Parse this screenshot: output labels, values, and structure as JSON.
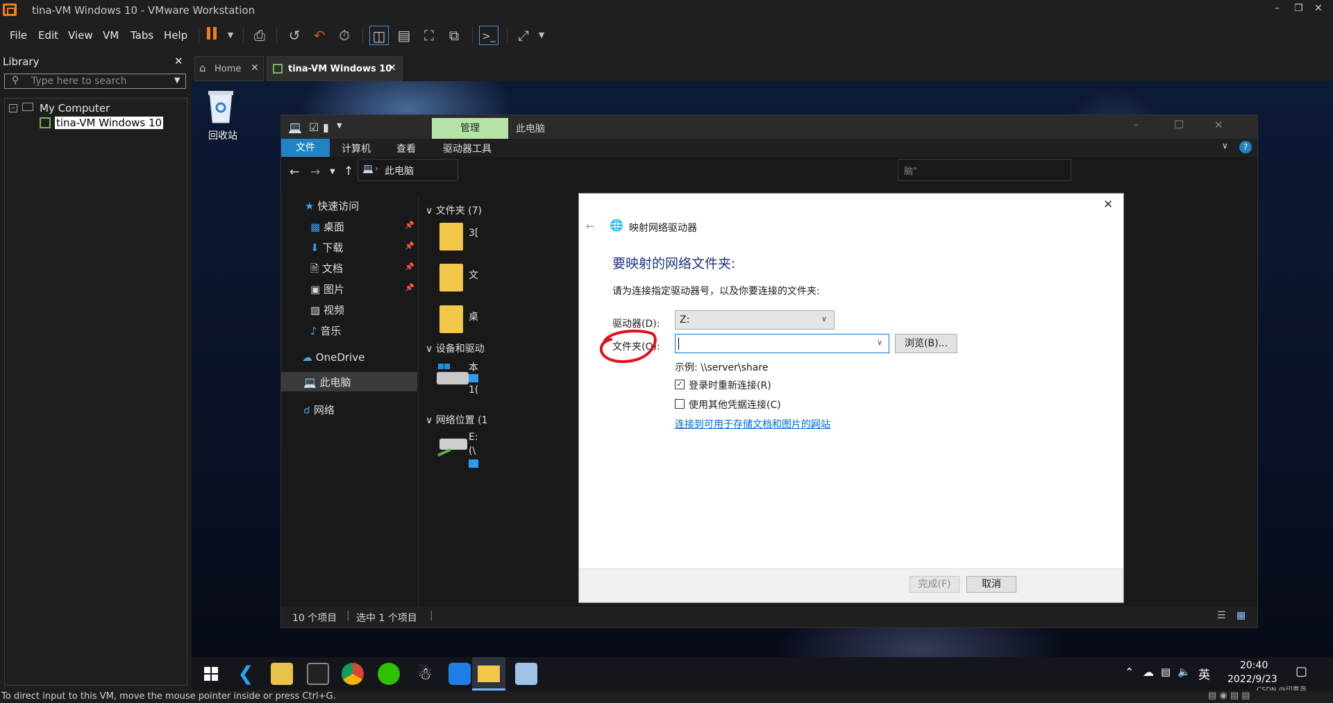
{
  "window": {
    "title": "tina-VM Windows 10 - VMware Workstation"
  },
  "menu": [
    "File",
    "Edit",
    "View",
    "VM",
    "Tabs",
    "Help"
  ],
  "library": {
    "header": "Library",
    "search_placeholder": "Type here to search",
    "tree_root": "My Computer",
    "tree_child": "tina-VM Windows 10"
  },
  "tabs": [
    {
      "label": "Home"
    },
    {
      "label": "tina-VM Windows 10"
    }
  ],
  "desktop": {
    "recycle_bin": "回收站"
  },
  "explorer": {
    "ribbon_context": "管理",
    "title": "此电脑",
    "ribbon_tabs": [
      "文件",
      "计算机",
      "查看",
      "驱动器工具"
    ],
    "address": "此电脑",
    "search_fragment": "脑\"",
    "nav": {
      "quick_access": "快速访问",
      "items": [
        "桌面",
        "下载",
        "文档",
        "图片",
        "视频",
        "音乐"
      ],
      "onedrive": "OneDrive",
      "this_pc": "此电脑",
      "network": "网络"
    },
    "groups": {
      "folders": "文件夹 (7)",
      "devices": "设备和驱动",
      "netloc": "网络位置 (1"
    },
    "folder_fragments": [
      "3[",
      "文",
      "桌"
    ],
    "device_fragments": [
      "本",
      "1("
    ],
    "netloc_fragments": [
      "E:",
      "(\\"
    ],
    "status": {
      "count": "10 个项目",
      "selected": "选中 1 个项目"
    }
  },
  "dialog": {
    "title": "映射网络驱动器",
    "heading": "要映射的网络文件夹:",
    "instruction": "请为连接指定驱动器号，以及你要连接的文件夹:",
    "drive_label": "驱动器(D):",
    "drive_value": "Z:",
    "folder_label": "文件夹(O):",
    "folder_value": "",
    "browse": "浏览(B)...",
    "example": "示例: \\\\server\\share",
    "reconnect": "登录时重新连接(R)",
    "reconnect_checked": true,
    "other_creds": "使用其他凭据连接(C)",
    "other_creds_checked": false,
    "link": "连接到可用于存储文档和图片的网站",
    "link_suffix": "。",
    "finish": "完成(F)",
    "cancel": "取消"
  },
  "taskbar": {
    "ime": "英",
    "time": "20:40",
    "date": "2022/9/23"
  },
  "statusbar": {
    "text": "To direct input to this VM, move the mouse pointer inside or press Ctrl+G."
  },
  "watermark": "CSDN @印青尧",
  "colors": {
    "accent": "#0078d7",
    "link": "#0066cc",
    "heading": "#1e3287",
    "annotation": "#e0101c",
    "ribbon_context": "#b6e3a8"
  }
}
